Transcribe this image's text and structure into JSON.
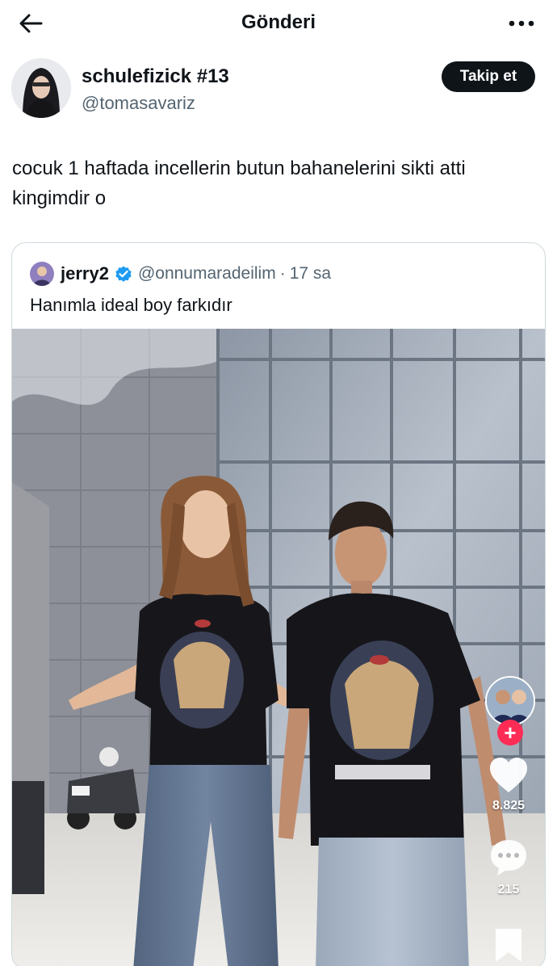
{
  "header": {
    "title": "Gönderi",
    "back_icon": "arrow-left-icon",
    "more_icon": "more-horizontal-icon"
  },
  "post": {
    "author": {
      "display_name": "schulefizick #13",
      "handle": "@tomasavariz"
    },
    "follow_label": "Takip et",
    "text": "cocuk 1 haftada incellerin butun bahanelerini sikti atti kingimdir o"
  },
  "quoted_post": {
    "author": {
      "display_name": "jerry2",
      "handle": "@onnumaradeilim",
      "verified": true
    },
    "separator": "·",
    "time": "17 sa",
    "text": "Hanımla ideal boy farkıdır",
    "media": {
      "tiktok_like_count": "8.825",
      "tiktok_comment_count": "215",
      "tiktok_plus": "+"
    }
  },
  "colors": {
    "text_primary": "#0f1419",
    "text_secondary": "#536471",
    "border": "#cfd9de",
    "verified_blue": "#1d9bf0",
    "tiktok_red": "#fe2c55"
  }
}
